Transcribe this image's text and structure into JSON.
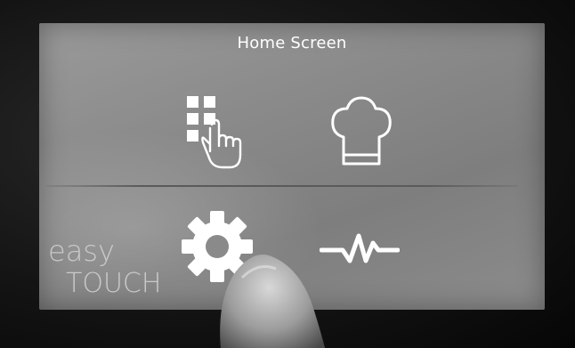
{
  "screen": {
    "title": "Home Screen"
  },
  "tiles": [
    {
      "id": "menu",
      "icon": "grid-tap-icon"
    },
    {
      "id": "recipe",
      "icon": "chef-hat-icon"
    },
    {
      "id": "settings",
      "icon": "gear-icon"
    },
    {
      "id": "monitor",
      "icon": "pulse-icon"
    }
  ],
  "brand": {
    "line1": "easy",
    "line2": "TOUCH"
  },
  "colors": {
    "screen_bg": "#8a8a8a",
    "icon": "#ffffff",
    "bezel": "#0c0c0c"
  }
}
